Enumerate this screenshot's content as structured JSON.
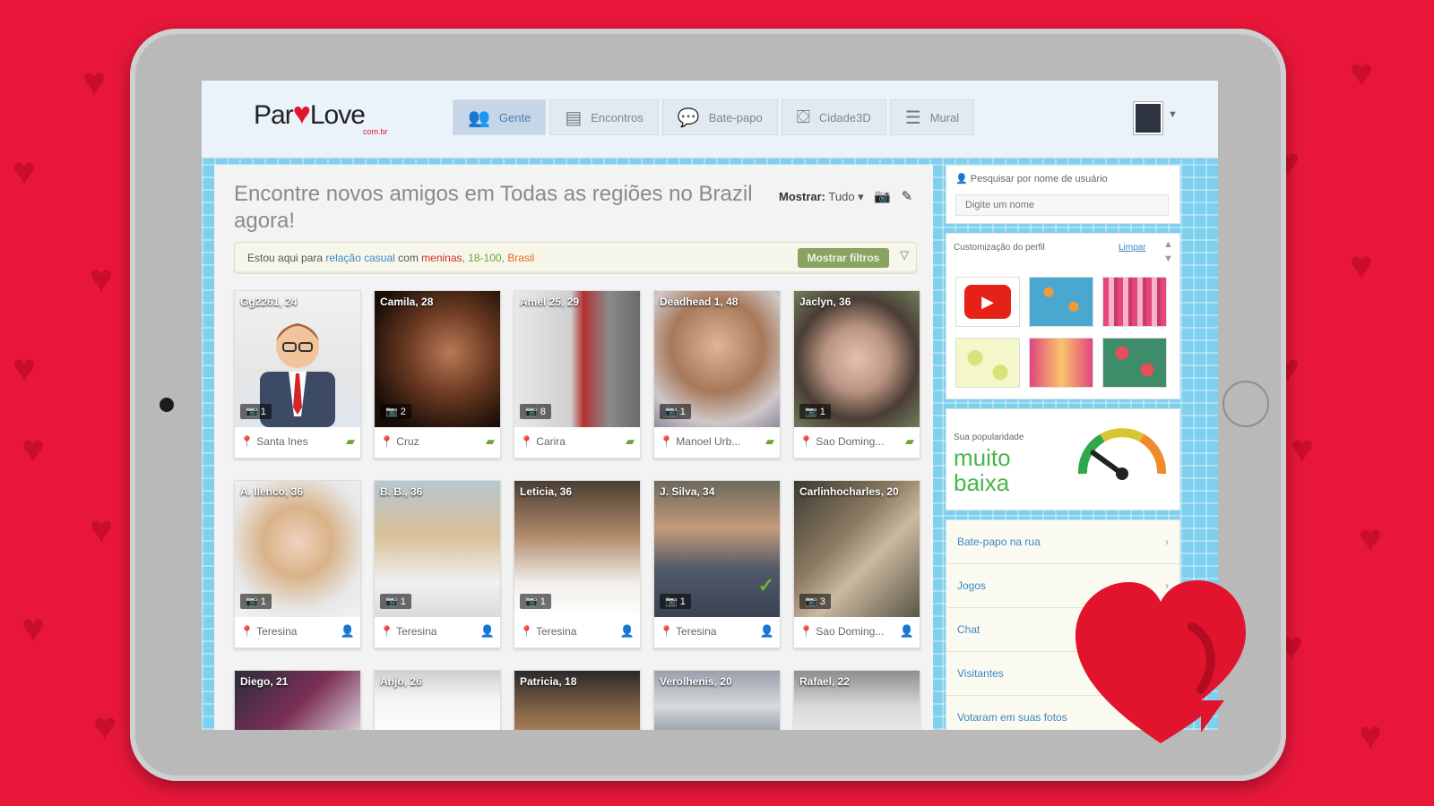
{
  "app": {
    "logo": "Par",
    "logo_heart": "♥",
    "logo_tail": "Love",
    "logo_domain": "com.br"
  },
  "nav": [
    {
      "label": "Gente",
      "icon": "people-icon",
      "active": true
    },
    {
      "label": "Encontros",
      "icon": "cards-icon",
      "active": false
    },
    {
      "label": "Bate-papo",
      "icon": "chat-icon",
      "active": false
    },
    {
      "label": "Cidade3D",
      "icon": "3d-icon",
      "active": false
    },
    {
      "label": "Mural",
      "icon": "list-icon",
      "active": false
    }
  ],
  "main": {
    "headline": "Encontre novos amigos em Todas as regiões no Brazil agora!",
    "show_label": "Mostrar:",
    "show_value": "Tudo ▾",
    "filter": {
      "prefix": "Estou aqui para",
      "intent": "relação casual",
      "with": "com",
      "who": "meninas,",
      "ages": "18-100,",
      "place": "Brasil",
      "button": "Mostrar filtros"
    }
  },
  "profiles_row1": [
    {
      "name": "Gg2261, 24",
      "photos": "1",
      "location": "Santa Ines",
      "action": "chat"
    },
    {
      "name": "Camila, 28",
      "photos": "2",
      "location": "Cruz",
      "action": "chat"
    },
    {
      "name": "Amel 25, 29",
      "photos": "8",
      "location": "Carira",
      "action": "chat"
    },
    {
      "name": "Deadhead 1, 48",
      "photos": "1",
      "location": "Manoel Urb...",
      "action": "chat"
    },
    {
      "name": "Jaclyn, 36",
      "photos": "1",
      "location": "Sao Doming...",
      "action": "chat"
    }
  ],
  "profiles_row2": [
    {
      "name": "A. Ilenco, 36",
      "photos": "1",
      "location": "Teresina",
      "action": "friend"
    },
    {
      "name": "B. B., 36",
      "photos": "1",
      "location": "Teresina",
      "action": "friend"
    },
    {
      "name": "Leticia, 36",
      "photos": "1",
      "location": "Teresina",
      "action": "friend"
    },
    {
      "name": "J. Silva, 34",
      "photos": "1",
      "location": "Teresina",
      "action": "friend",
      "verified": true
    },
    {
      "name": "Carlinhocharles, 20",
      "photos": "3",
      "location": "Sao Doming...",
      "action": "friend"
    }
  ],
  "profiles_row3": [
    {
      "name": "Diego, 21"
    },
    {
      "name": "Anjo, 26"
    },
    {
      "name": "Patricia, 18"
    },
    {
      "name": "Verolhenis, 20"
    },
    {
      "name": "Rafael, 22"
    }
  ],
  "sidebar": {
    "search_label": "Pesquisar por nome de usuário",
    "search_placeholder": "Digite um nome",
    "custom_title": "Customização do perfil",
    "custom_clear": "Limpar",
    "popularity_label": "Sua popularidade",
    "popularity_value": "muito baixa",
    "popularity_level": 0.2,
    "menu": [
      {
        "label": "Bate-papo na rua"
      },
      {
        "label": "Jogos"
      },
      {
        "label": "Chat"
      },
      {
        "label": "Visitantes"
      },
      {
        "label": "Votaram em suas fotos"
      }
    ]
  },
  "colors": {
    "brand": "#e8173a",
    "accent_blue": "#3b88c6",
    "accent_green": "#6aa535"
  }
}
